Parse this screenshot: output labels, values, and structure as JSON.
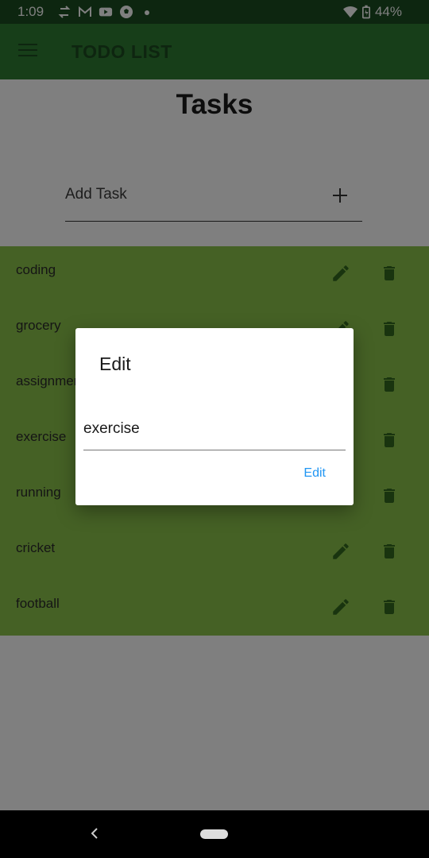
{
  "status_bar": {
    "time": "1:09",
    "battery": "44%",
    "icons": [
      "sync-icon",
      "gmail-icon",
      "youtube-icon",
      "soccer-icon",
      "dot-icon",
      "wifi-icon",
      "battery-icon"
    ]
  },
  "app_bar": {
    "title": "TODO LIST",
    "color": "#2e7d32"
  },
  "page": {
    "title": "Tasks",
    "add_task_placeholder": "Add Task"
  },
  "tasks": [
    {
      "label": "coding"
    },
    {
      "label": "grocery"
    },
    {
      "label": "assignment"
    },
    {
      "label": "exercise"
    },
    {
      "label": "running"
    },
    {
      "label": "cricket"
    },
    {
      "label": "football"
    }
  ],
  "dialog": {
    "title": "Edit",
    "field_value": "exercise",
    "confirm_label": "Edit"
  },
  "colors": {
    "task_list_bg": "#8bc34a",
    "accent": "#2196f3"
  }
}
